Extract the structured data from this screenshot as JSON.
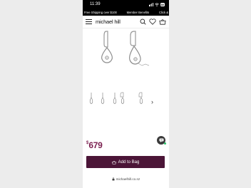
{
  "status_bar": {
    "time": "11:39",
    "battery": "80"
  },
  "promo_bar": {
    "left": "Free Shipping over $100",
    "middle": "Member Benefits",
    "right": "Click &"
  },
  "header": {
    "logo": "michael hill"
  },
  "product": {
    "currency_symbol": "$",
    "price": "679"
  },
  "buttons": {
    "add_to_bag": "Add to Bag"
  },
  "browser": {
    "url": "michaelhill.co.nz"
  },
  "icons": {
    "menu": "hamburger-menu-icon",
    "search": "search-icon",
    "wishlist": "heart-icon",
    "bag": "shopping-bag-icon",
    "next": "chevron-right-icon",
    "chat": "chat-icon",
    "lock": "lock-icon"
  },
  "colors": {
    "price": "#7a1f4f",
    "button": "#4b1537",
    "chat": "#3a3a3a",
    "online": "#2ec06b"
  }
}
